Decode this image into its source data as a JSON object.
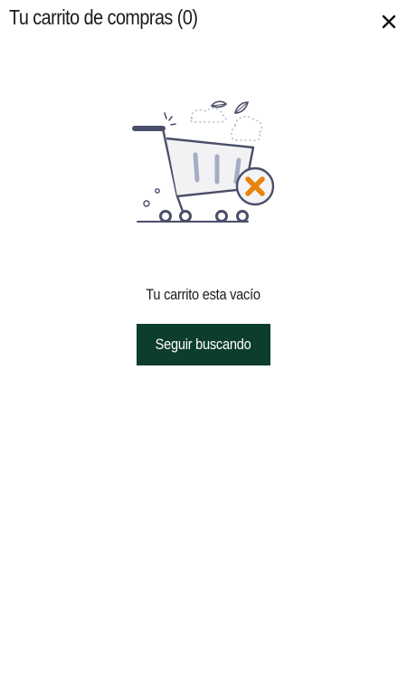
{
  "header": {
    "title": "Tu carrito de compras (0)"
  },
  "empty_state": {
    "message": "Tu carrito esta vacío",
    "illustration_icon": "empty-cart-icon",
    "remove_badge_icon": "x-icon"
  },
  "actions": {
    "continue_label": "Seguir buscando"
  },
  "colors": {
    "button_bg": "#0d3d2b",
    "button_text": "#ffffff",
    "accent_orange": "#e8830c",
    "cart_stroke": "#4a4e69"
  }
}
